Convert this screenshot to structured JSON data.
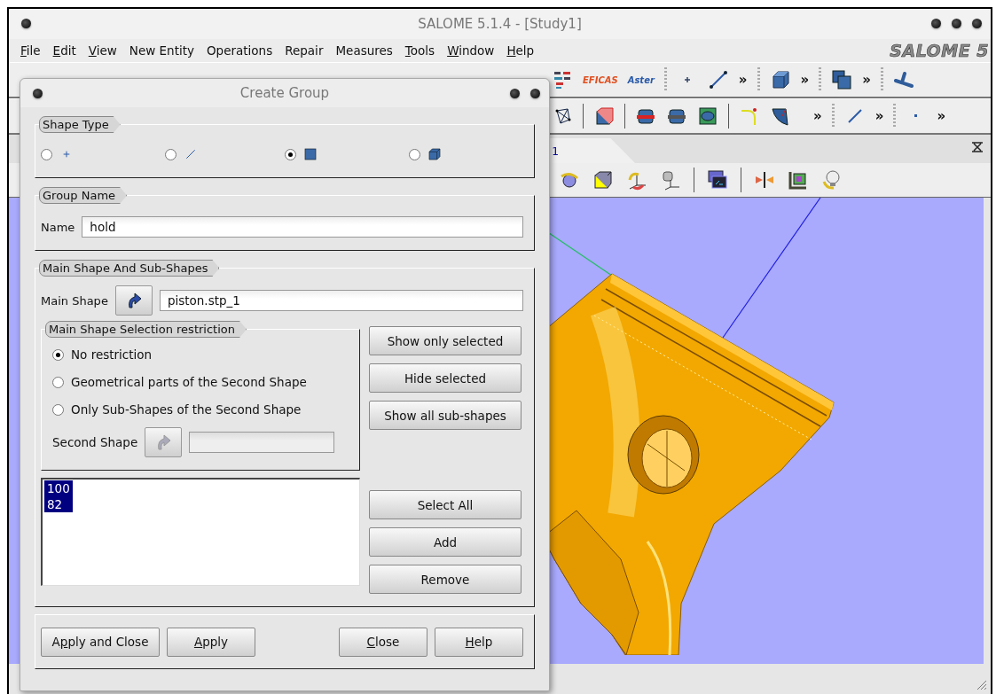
{
  "window": {
    "title": "SALOME 5.1.4 - [Study1]",
    "logo": "SALOME 5"
  },
  "menu": [
    {
      "label": "File",
      "mnemonic_first": true
    },
    {
      "label": "Edit",
      "mnemonic_first": true
    },
    {
      "label": "View",
      "mnemonic_first": true
    },
    {
      "label": "New Entity"
    },
    {
      "label": "Operations"
    },
    {
      "label": "Repair"
    },
    {
      "label": "Measures"
    },
    {
      "label": "Tools",
      "mnemonic_first": true
    },
    {
      "label": "Window",
      "mnemonic_first": true
    },
    {
      "label": "Help",
      "mnemonic_first": true
    }
  ],
  "toolbar_1": {
    "labels": [
      "EFICAS",
      "Aster"
    ],
    "overflow": [
      "»",
      "»",
      "»"
    ]
  },
  "toolbar_2": {
    "overflow": [
      "»",
      "»",
      "»"
    ]
  },
  "view_tab": {
    "title": "1"
  },
  "dialog": {
    "title": "Create Group",
    "shape_type": {
      "legend": "Shape Type",
      "options": [
        {
          "kind": "point",
          "selected": false
        },
        {
          "kind": "edge",
          "selected": false
        },
        {
          "kind": "face",
          "selected": true
        },
        {
          "kind": "solid",
          "selected": false
        }
      ]
    },
    "group_name": {
      "legend": "Group Name",
      "label": "Name",
      "value": "hold"
    },
    "main": {
      "legend": "Main Shape And Sub-Shapes",
      "main_shape_label": "Main Shape",
      "main_shape_value": "piston.stp_1",
      "restriction": {
        "legend": "Main Shape Selection restriction",
        "options": [
          {
            "label": "No restriction",
            "selected": true
          },
          {
            "label": "Geometrical parts of the Second Shape",
            "selected": false
          },
          {
            "label": "Only Sub-Shapes of the Second Shape",
            "selected": false
          }
        ],
        "second_shape_label": "Second Shape",
        "second_shape_disabled": true
      },
      "view_buttons": [
        "Show only selected",
        "Hide selected",
        "Show all sub-shapes"
      ],
      "ids": [
        {
          "text": "100",
          "selected": true
        },
        {
          "text": "82",
          "selected": true
        }
      ],
      "list_buttons": [
        "Select All",
        "Add",
        "Remove"
      ]
    },
    "buttons": [
      {
        "label": "Apply and Close",
        "mnemonic_second": true
      },
      {
        "label": "Apply",
        "mnemonic_first": true
      },
      {
        "label": "Close",
        "mnemonic_first": true
      },
      {
        "label": "Help",
        "mnemonic_first": true
      }
    ]
  }
}
